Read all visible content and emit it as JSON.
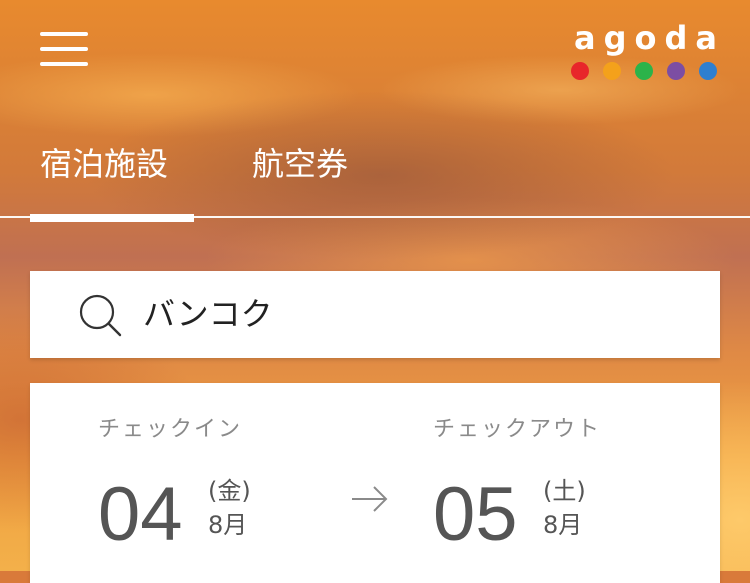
{
  "header": {
    "logo_text": "agoda",
    "logo_dot_colors": [
      "#e8262a",
      "#f4a11b",
      "#2cb34a",
      "#7c4ea3",
      "#2f7fcf"
    ],
    "menu_icon": "hamburger-menu-icon"
  },
  "tabs": [
    {
      "label": "宿泊施設",
      "active": true
    },
    {
      "label": "航空券",
      "active": false
    }
  ],
  "search": {
    "icon": "search-icon",
    "value": "バンコク"
  },
  "dates": {
    "checkin": {
      "label": "チェックイン",
      "day": "04",
      "weekday": "(金)",
      "month": "8月"
    },
    "arrow_icon": "arrow-right-icon",
    "checkout": {
      "label": "チェックアウト",
      "day": "05",
      "weekday": "(土)",
      "month": "8月"
    }
  },
  "colors": {
    "card_bg": "#ffffff",
    "label_gray": "#8a8a8a",
    "date_text": "#555555"
  }
}
